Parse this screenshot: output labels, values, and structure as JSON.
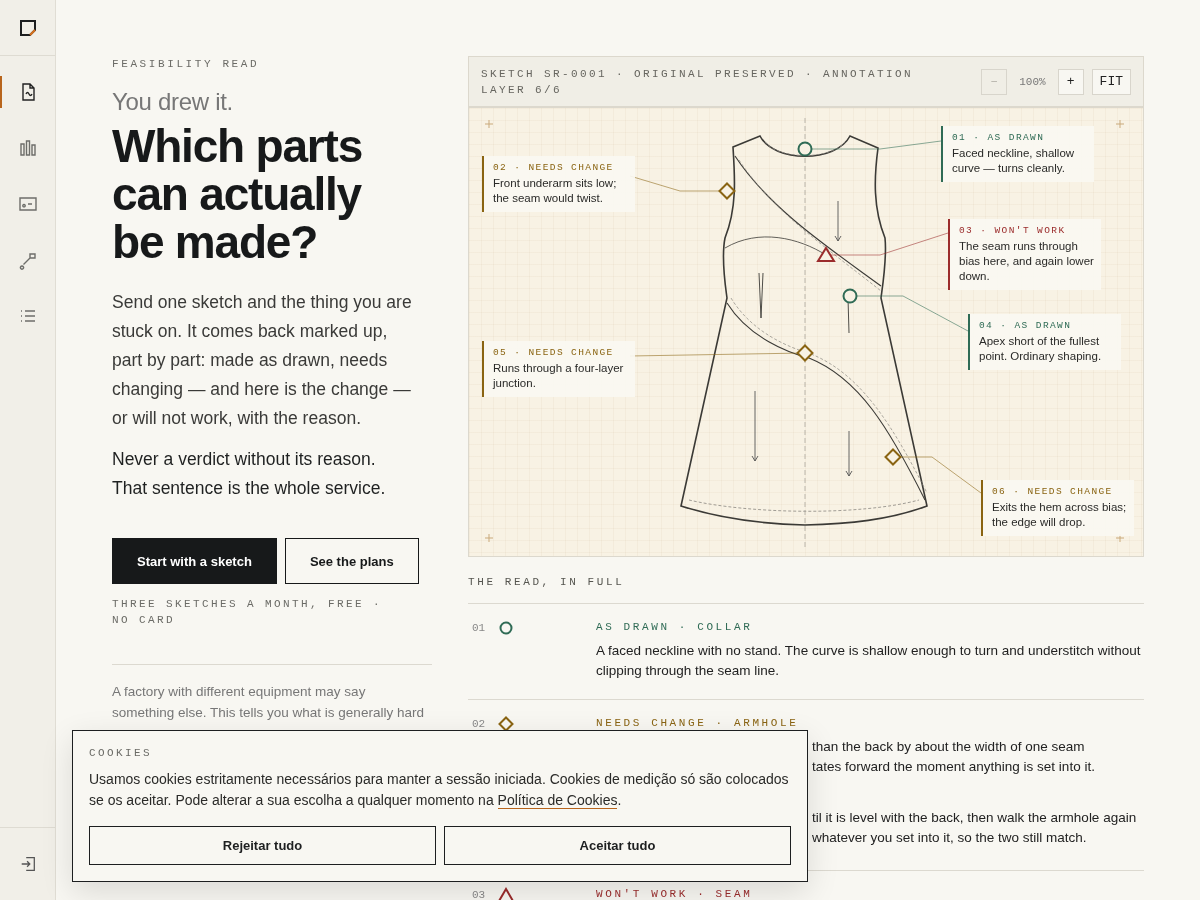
{
  "sidebar": {
    "items": [
      {
        "selected": true
      },
      {
        "selected": false
      },
      {
        "selected": false
      },
      {
        "selected": false
      },
      {
        "selected": false
      }
    ]
  },
  "hero": {
    "eyebrow": "FEASIBILITY READ",
    "lead": "You drew it.",
    "title": "Which parts can actually be made?",
    "intro": "Send one sketch and the thing you are stuck on. It comes back marked up, part by part: made as drawn, needs changing — and here is the change — or will not work, with the reason.",
    "statement": "Never a verdict without its reason. That sentence is the whole service.",
    "primary_button": "Start with a sketch",
    "secondary_button": "See the plans",
    "note": "THREE SKETCHES A MONTH, FREE · NO CARD",
    "footnote": "A factory with different equipment may say something else. This tells you what is generally hard"
  },
  "sketch": {
    "caption": "SKETCH SR-0001 · ORIGINAL PRESERVED · ANNOTATION LAYER 6/6",
    "zoom_out": {
      "label": "–",
      "disabled": true
    },
    "zoom_level": "100%",
    "zoom_in": {
      "label": "+",
      "disabled": false
    },
    "fit": "FIT",
    "annotations": [
      {
        "label": "01 · AS DRAWN",
        "kind": "as_drawn",
        "text": "Faced neckline, shallow curve — turns cleanly."
      },
      {
        "label": "02 · NEEDS CHANGE",
        "kind": "needs_change",
        "text": "Front underarm sits low; the seam would twist."
      },
      {
        "label": "03 · WON'T WORK",
        "kind": "wont_work",
        "text": "The seam runs through bias here, and again lower down."
      },
      {
        "label": "04 · AS DRAWN",
        "kind": "as_drawn",
        "text": "Apex short of the fullest point. Ordinary shaping."
      },
      {
        "label": "05 · NEEDS CHANGE",
        "kind": "needs_change",
        "text": "Runs through a four-layer junction."
      },
      {
        "label": "06 · NEEDS CHANGE",
        "kind": "needs_change",
        "text": "Exits the hem across bias; the edge will drop."
      }
    ]
  },
  "read": {
    "heading": "THE READ, IN FULL",
    "rows": [
      {
        "number": "01",
        "kind": "as_drawn",
        "label": "AS DRAWN · COLLAR",
        "paragraphs": [
          "A faced neckline with no stand. The curve is shallow enough to turn and understitch without clipping through the seam line."
        ]
      },
      {
        "number": "02",
        "kind": "needs_change",
        "label": "NEEDS CHANGE · ARMHOLE",
        "visible_fragments": [
          [
            "than the back by about the width of one seam",
            "tates forward the moment anything is set into it."
          ],
          [
            "til it is level with the back, then walk the armhole again",
            "whatever you set into it, so the two still match."
          ]
        ]
      },
      {
        "number": "03",
        "kind": "wont_work",
        "label": "WON'T WORK · SEAM"
      }
    ]
  },
  "cookies": {
    "title": "COOKIES",
    "text_before": "Usamos cookies estritamente necessários para manter a sessão iniciada. Cookies de medição só são colocados se os aceitar. Pode alterar a sua escolha a qualquer momento na ",
    "link": "Política de Cookies",
    "text_after": ".",
    "reject": "Rejeitar tudo",
    "accept": "Aceitar tudo"
  }
}
